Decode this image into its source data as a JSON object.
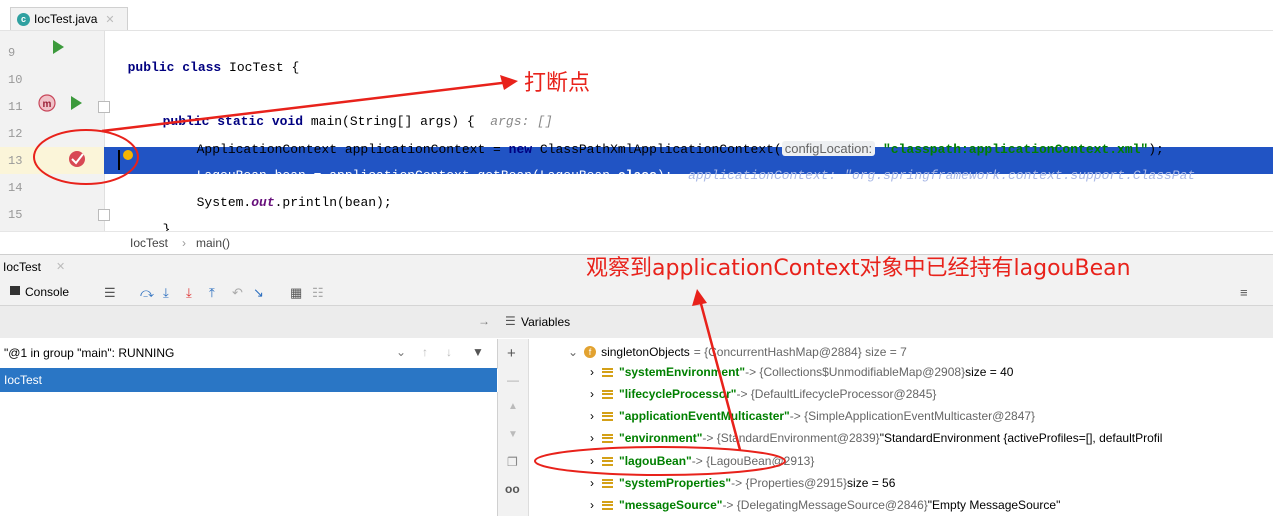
{
  "tab": {
    "filename": "IocTest.java",
    "icon": "class-c-icon"
  },
  "editor": {
    "lines": [
      {
        "n": "9"
      },
      {
        "n": "10"
      },
      {
        "n": "11"
      },
      {
        "n": "12"
      },
      {
        "n": "13"
      },
      {
        "n": "14"
      },
      {
        "n": "15"
      }
    ],
    "code": {
      "l9_kw": "public class",
      "l9_rest": " IocTest {",
      "l11_kw": "public static void",
      "l11_rest": " main(String[] args) {",
      "l11_hint": "args: []",
      "l12_pre": "ApplicationContext applicationContext = ",
      "l12_kw": "new",
      "l12_rest": " ClassPathXmlApplicationContext(",
      "l12_param": "configLocation:",
      "l12_str": "\"classpath:applicationContext.xml\"",
      "l12_end": ");",
      "l13_code": "LagouBean bean = applicationContext.getBean(LagouBean.",
      "l13_kw": "class",
      "l13_end": ");",
      "l13_hint": "applicationContext: \"org.springframework.context.support.ClassPat",
      "l14_pre": "System.",
      "l14_out": "out",
      "l14_rest": ".println(bean);",
      "l15": "}"
    }
  },
  "breadcrumb": {
    "class": "IocTest",
    "sep": "›",
    "method": "main()"
  },
  "debug": {
    "title": "IocTest",
    "console_tab": "Console",
    "thread": "\"@1 in group \"main\": RUNNING",
    "frame": "IocTest",
    "variables_title": "Variables",
    "root": {
      "key": "singletonObjects",
      "value": "= {ConcurrentHashMap@2884}  size = 7"
    },
    "vars": [
      {
        "key": "\"systemEnvironment\"",
        "value": " -> {Collections$UnmodifiableMap@2908}",
        "extra": "  size = 40"
      },
      {
        "key": "\"lifecycleProcessor\"",
        "value": " -> {DefaultLifecycleProcessor@2845}",
        "extra": ""
      },
      {
        "key": "\"applicationEventMulticaster\"",
        "value": " -> {SimpleApplicationEventMulticaster@2847}",
        "extra": ""
      },
      {
        "key": "\"environment\"",
        "value": " -> {StandardEnvironment@2839}",
        "extra": " \"StandardEnvironment {activeProfiles=[], defaultProfil"
      },
      {
        "key": "\"lagouBean\"",
        "value": " -> {LagouBean@2913}",
        "extra": ""
      },
      {
        "key": "\"systemProperties\"",
        "value": " -> {Properties@2915}",
        "extra": "  size = 56"
      },
      {
        "key": "\"messageSource\"",
        "value": " -> {DelegatingMessageSource@2846}",
        "extra": " \"Empty MessageSource\""
      }
    ]
  },
  "annotations": {
    "breakpoint": "打断点",
    "observe": "观察到applicationContext对象中已经持有lagouBean"
  },
  "colors": {
    "accent": "#2154c4",
    "annotation": "#e8221b",
    "run": "#3c9a3c"
  }
}
